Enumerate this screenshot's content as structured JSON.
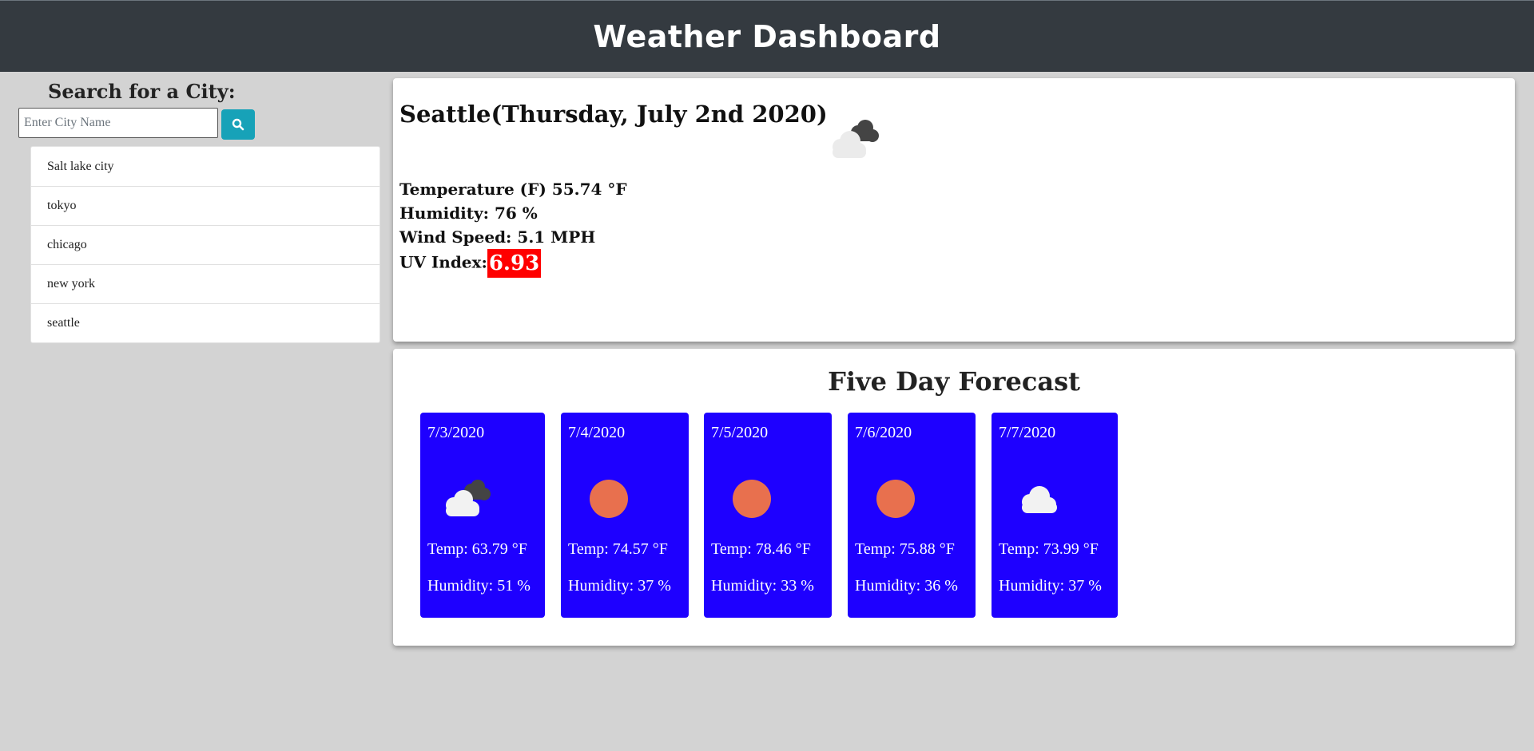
{
  "header": {
    "title": "Weather Dashboard"
  },
  "search": {
    "title": "Search for a City:",
    "placeholder": "Enter City Name",
    "value": "",
    "button_icon": "search-icon"
  },
  "history": {
    "cities": [
      "Salt lake city",
      "tokyo",
      "chicago",
      "new york",
      "seattle"
    ]
  },
  "current": {
    "heading": "Seattle(Thursday, July 2nd 2020)",
    "icon": "broken-clouds-icon",
    "temperature": "Temperature (F) 55.74 °F",
    "humidity": "Humidity: 76 %",
    "wind": "Wind Speed: 5.1 MPH",
    "uv_label": "UV Index:",
    "uv_value": "6.93",
    "uv_color": "#ff0000"
  },
  "forecast": {
    "title": "Five Day Forecast",
    "card_color": "#1e00ff",
    "days": [
      {
        "date": "7/3/2020",
        "icon": "broken-clouds-icon",
        "temp": "Temp: 63.79 °F",
        "humidity": "Humidity: 51 %"
      },
      {
        "date": "7/4/2020",
        "icon": "sun-icon",
        "temp": "Temp: 74.57 °F",
        "humidity": "Humidity: 37 %"
      },
      {
        "date": "7/5/2020",
        "icon": "sun-icon",
        "temp": "Temp: 78.46 °F",
        "humidity": "Humidity: 33 %"
      },
      {
        "date": "7/6/2020",
        "icon": "sun-icon",
        "temp": "Temp: 75.88 °F",
        "humidity": "Humidity: 36 %"
      },
      {
        "date": "7/7/2020",
        "icon": "cloud-icon",
        "temp": "Temp: 73.99 °F",
        "humidity": "Humidity: 37 %"
      }
    ]
  }
}
